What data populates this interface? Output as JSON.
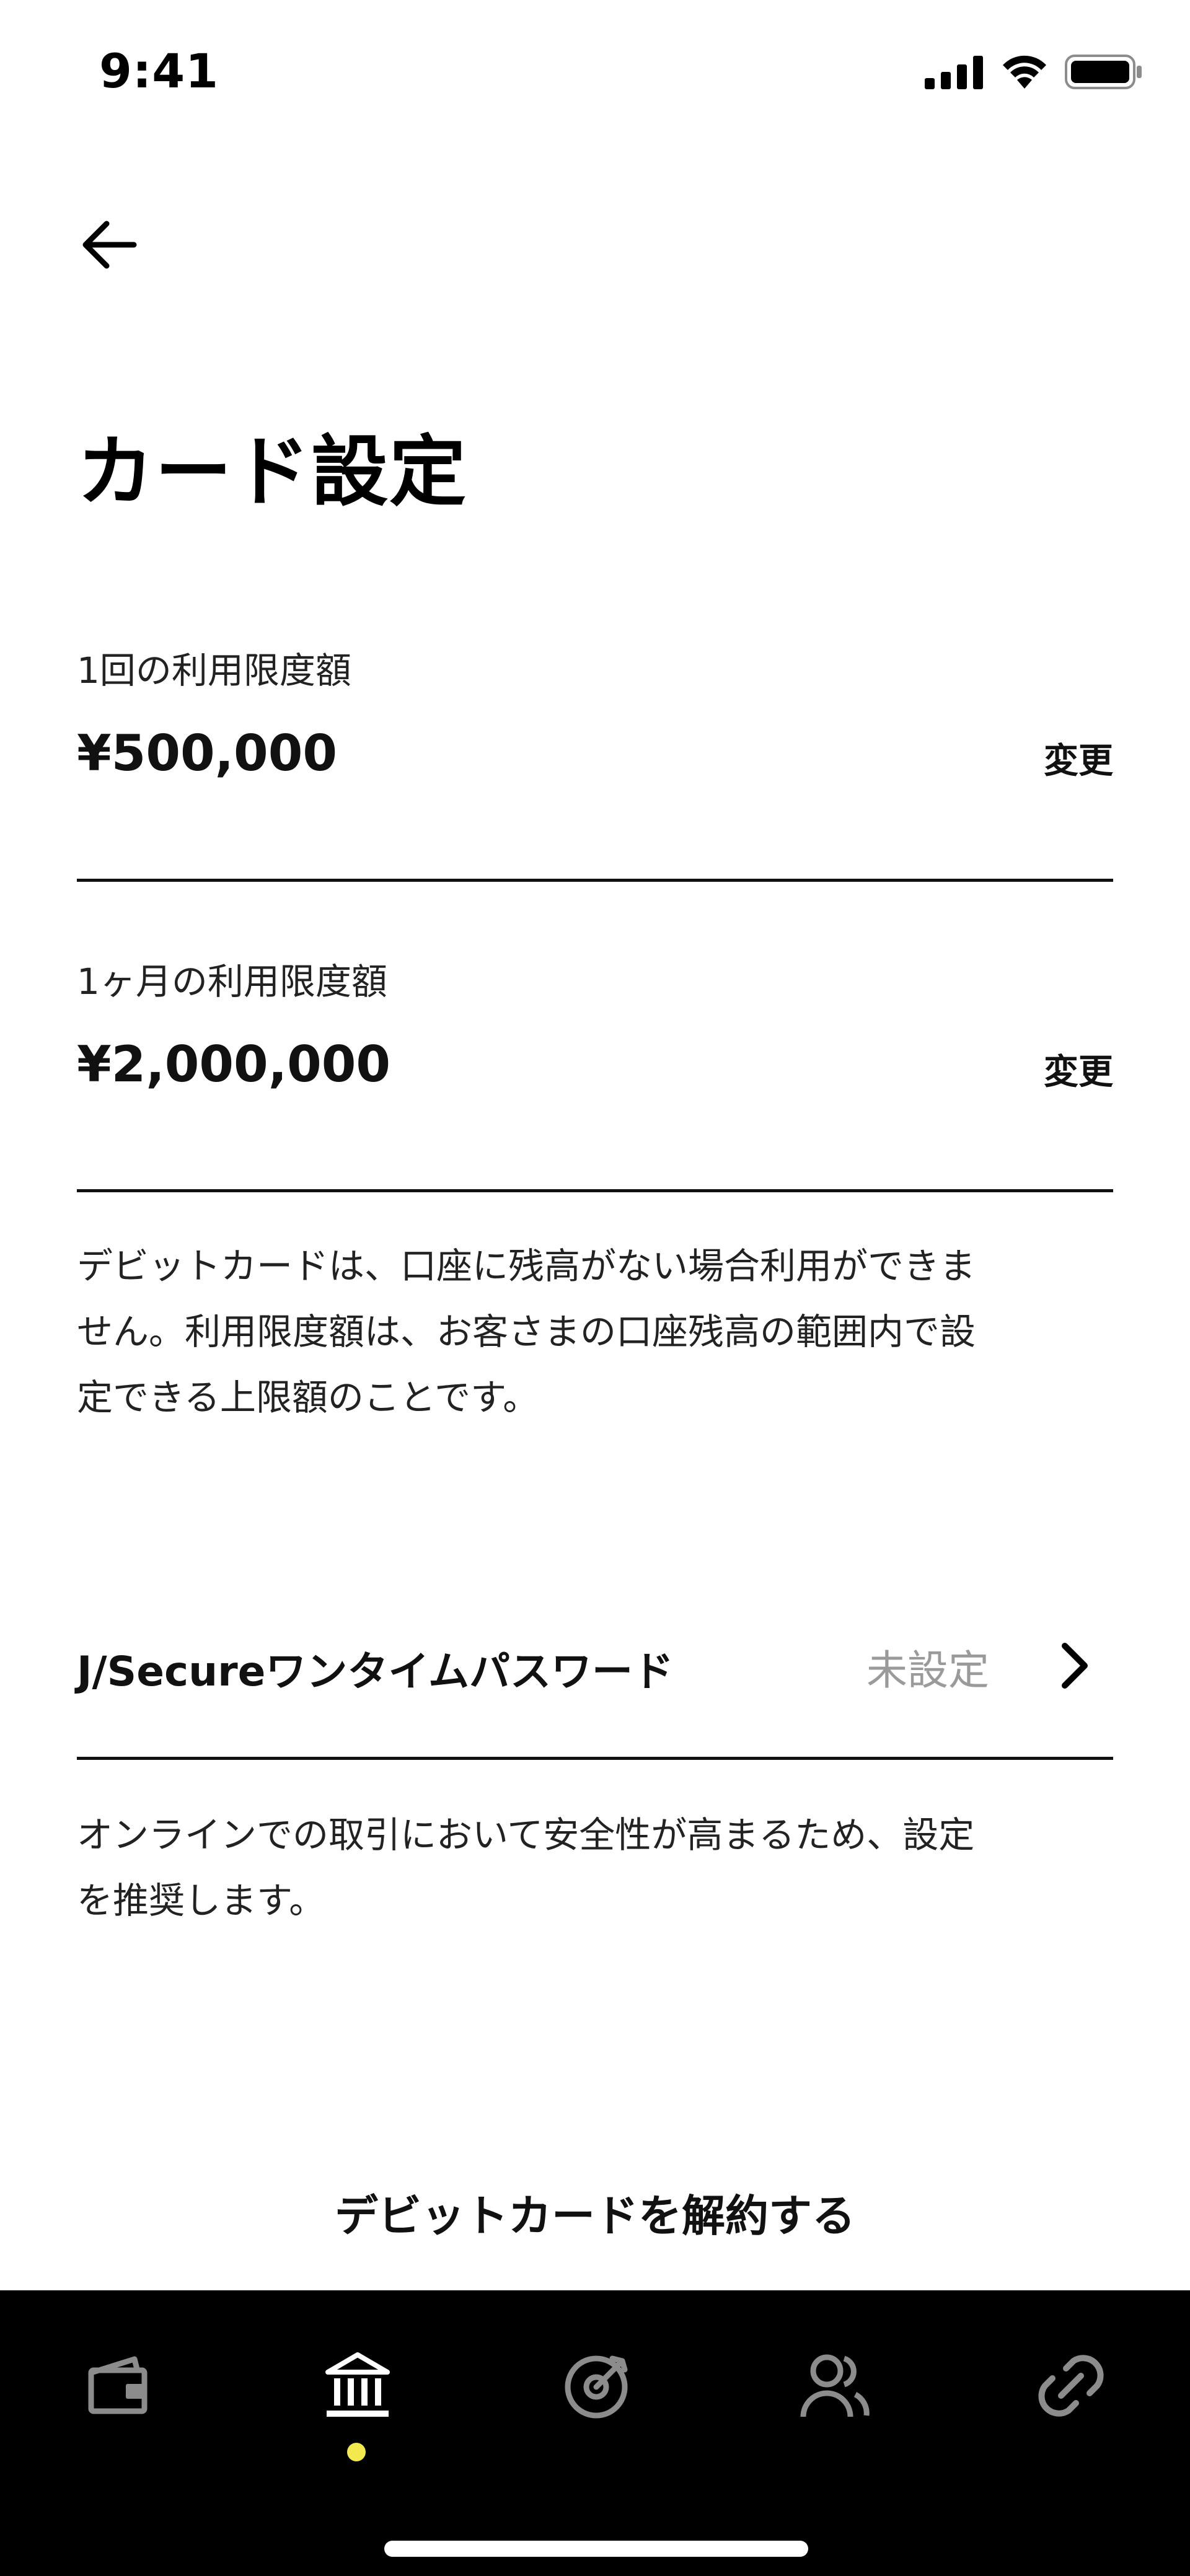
{
  "status_bar": {
    "time": "9:41",
    "icons": [
      "cellular-signal-icon",
      "wifi-icon",
      "battery-icon"
    ]
  },
  "navigation": {
    "back_icon": "arrow-left-icon"
  },
  "page": {
    "title": "カード設定"
  },
  "limits": [
    {
      "label": "1回の利用限度額",
      "value": "¥500,000",
      "action": "変更"
    },
    {
      "label": "1ヶ月の利用限度額",
      "value": "¥2,000,000",
      "action": "変更"
    }
  ],
  "limits_notice": {
    "lines": [
      "デビットカードは、口座に残高がない場合利用ができま",
      "せん。利用限度額は、お客さまの口座残高の範囲内で設",
      "定できる上限額のことです。"
    ]
  },
  "j_secure": {
    "label": "J/Secureワンタイムパスワード",
    "status": "未設定",
    "chevron": "chevron-right-icon"
  },
  "j_secure_notice": {
    "lines": [
      "オンラインでの取引において安全性が高まるため、設定",
      "を推奨します。"
    ]
  },
  "cancel": {
    "label": "デビットカードを解約する"
  },
  "tab_bar": {
    "active_index": 1,
    "tabs": [
      {
        "icon": "wallet-icon"
      },
      {
        "icon": "bank-icon"
      },
      {
        "icon": "target-icon"
      },
      {
        "icon": "people-icon"
      },
      {
        "icon": "link-icon"
      }
    ],
    "colors": {
      "background": "#000000",
      "active": "#ffffff",
      "inactive": "#8c8c8c",
      "indicator": "#f2e94e"
    }
  }
}
